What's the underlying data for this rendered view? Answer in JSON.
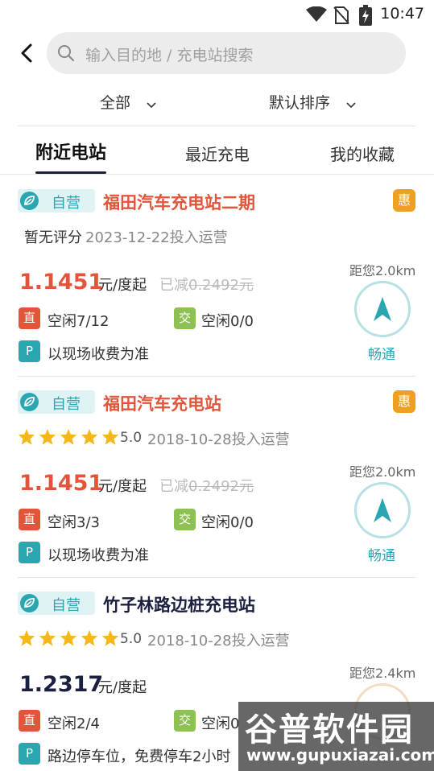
{
  "status_bar": {
    "time": "10:47"
  },
  "search": {
    "placeholder": "输入目的地 / 充电站搜索"
  },
  "filters": {
    "all": "全部",
    "sort": "默认排序"
  },
  "tabs": [
    {
      "label": "附近电站",
      "active": true
    },
    {
      "label": "最近充电",
      "active": false
    },
    {
      "label": "我的收藏",
      "active": false
    }
  ],
  "stations": [
    {
      "badge": "自营",
      "name": "福田汽车充电站二期",
      "name_color": "#e2553a",
      "promo": "惠",
      "rating_text": "暂无评分",
      "stars": null,
      "op_date": "2023-12-22投入运营",
      "price": "1.1451",
      "price_color": "#e2553a",
      "unit": "元/度起",
      "discount_prefix": "已减",
      "discount_amount": "0.2492元",
      "distance": "距您2.0km",
      "dc": {
        "tag": "直",
        "text": "空闲7/12"
      },
      "ac": {
        "tag": "交",
        "text": "空闲0/0"
      },
      "parking": {
        "tag": "P",
        "text": "以现场收费为准"
      },
      "traffic": "畅通"
    },
    {
      "badge": "自营",
      "name": "福田汽车充电站",
      "name_color": "#e2553a",
      "promo": "惠",
      "rating_value": "5.0",
      "stars": 5,
      "op_date": "2018-10-28投入运营",
      "price": "1.1451",
      "price_color": "#e2553a",
      "unit": "元/度起",
      "discount_prefix": "已减",
      "discount_amount": "0.2492元",
      "distance": "距您2.0km",
      "dc": {
        "tag": "直",
        "text": "空闲3/3"
      },
      "ac": {
        "tag": "交",
        "text": "空闲0/0"
      },
      "parking": {
        "tag": "P",
        "text": "以现场收费为准"
      },
      "traffic": "畅通"
    },
    {
      "badge": "自营",
      "name": "竹子林路边桩充电站",
      "name_color": "#1c2040",
      "rating_value": "5.0",
      "stars": 5,
      "op_date": "2018-10-28投入运营",
      "price": "1.2317",
      "price_color": "#1c2040",
      "unit": "元/度起",
      "distance": "距您2.4km",
      "dc": {
        "tag": "直",
        "text": "空闲2/4"
      },
      "ac": {
        "tag": "交",
        "text": "空闲0"
      },
      "parking": {
        "tag": "P",
        "text": "路边停车位，免费停车2小时"
      }
    }
  ],
  "watermark": {
    "title": "谷普软件园",
    "url": "www.gupuxiazai.com"
  },
  "colors": {
    "accent": "#2aa6b0",
    "price_red": "#e2553a",
    "promo_orange": "#f0a020",
    "star_yellow": "#f6b818"
  }
}
